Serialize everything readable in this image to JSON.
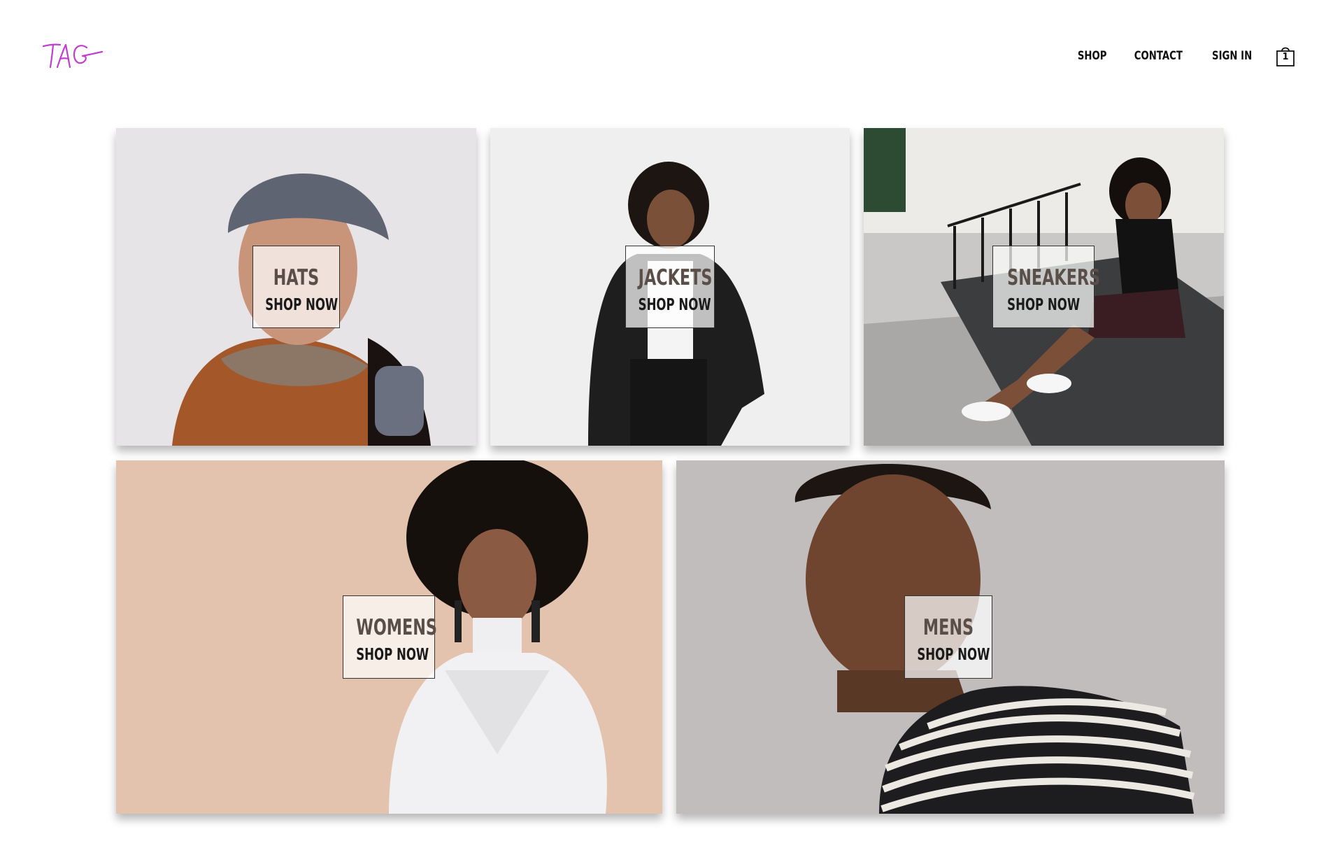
{
  "brand": {
    "logo_text": "TAG",
    "logo_color": "#c13fcf"
  },
  "nav": {
    "items": [
      {
        "label": "SHOP"
      },
      {
        "label": "CONTACT"
      },
      {
        "label": "SIGN IN"
      }
    ],
    "cart": {
      "icon": "shopping-bag-icon",
      "count": "1"
    }
  },
  "categories": [
    {
      "title": "HATS",
      "cta": "SHOP NOW",
      "bg": "#e6e4e6"
    },
    {
      "title": "JACKETS",
      "cta": "SHOP NOW",
      "bg": "#f0f0f0"
    },
    {
      "title": "SNEAKERS",
      "cta": "SHOP NOW",
      "bg": "#c9c8c6"
    },
    {
      "title": "WOMENS",
      "cta": "SHOP NOW",
      "bg": "#e3c3ae"
    },
    {
      "title": "MENS",
      "cta": "SHOP NOW",
      "bg": "#c2bdbd"
    }
  ]
}
